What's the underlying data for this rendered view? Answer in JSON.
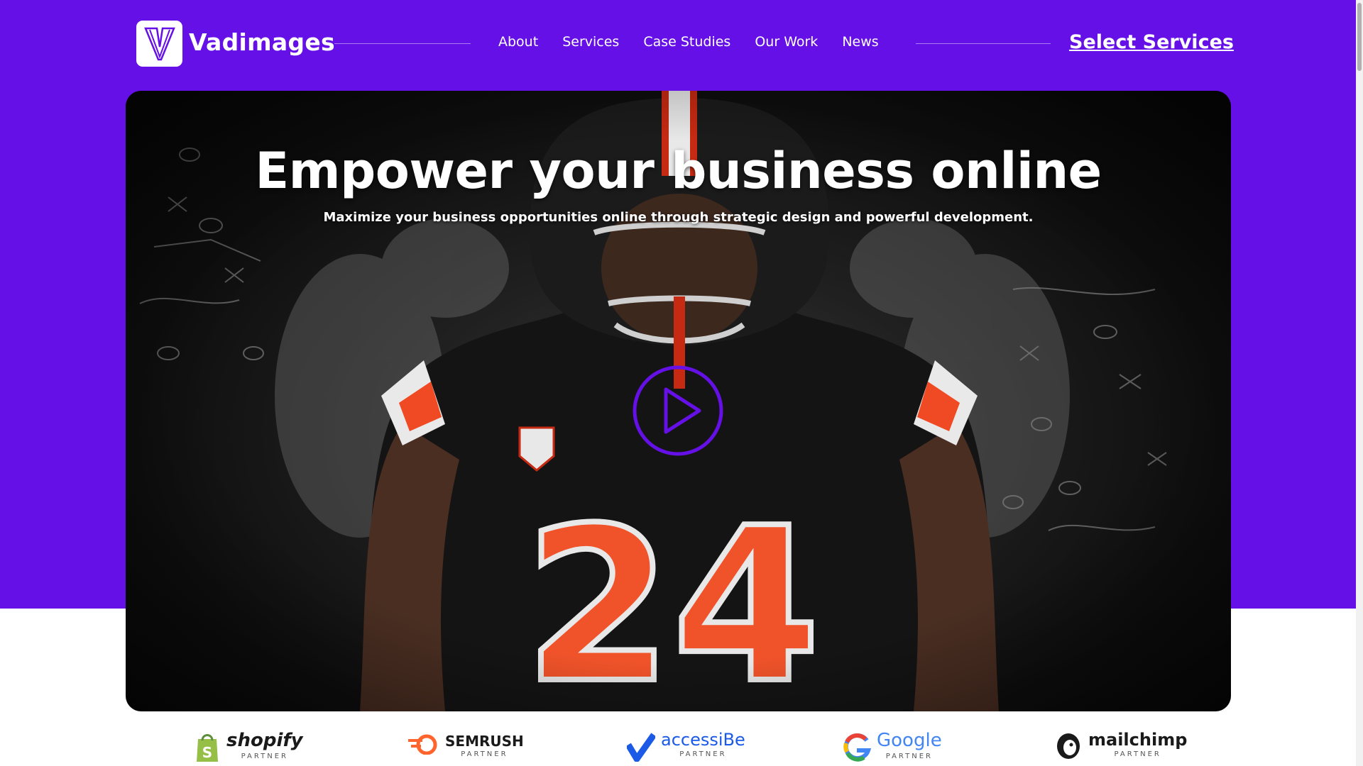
{
  "brand": {
    "name": "Vadimages",
    "logo_letter": "V",
    "accent": "#6510e6"
  },
  "nav": {
    "items": [
      {
        "label": "About"
      },
      {
        "label": "Services"
      },
      {
        "label": "Case Studies"
      },
      {
        "label": "Our Work"
      },
      {
        "label": "News"
      }
    ],
    "cta_label": "Select Services"
  },
  "hero": {
    "title": "Empower your business online",
    "subtitle": "Maximize your business opportunities online through strategic design and powerful development.",
    "play_icon": "play-circle-icon"
  },
  "partners": [
    {
      "name": "shopify",
      "tag": "PARTNER",
      "icon": "shopify-bag-icon",
      "color": "#1a1a1a"
    },
    {
      "name": "SEMRUSH",
      "tag": "PARTNER",
      "icon": "semrush-icon",
      "color": "#1a1a1a"
    },
    {
      "name": "accessiBe",
      "tag": "PARTNER",
      "icon": "accessibe-icon",
      "color": "#1a5ae6"
    },
    {
      "name": "Google",
      "tag": "PARTNER",
      "icon": "google-g-icon",
      "color": "#4285f4"
    },
    {
      "name": "mailchimp",
      "tag": "PARTNER",
      "icon": "mailchimp-icon",
      "color": "#1a1a1a"
    }
  ]
}
